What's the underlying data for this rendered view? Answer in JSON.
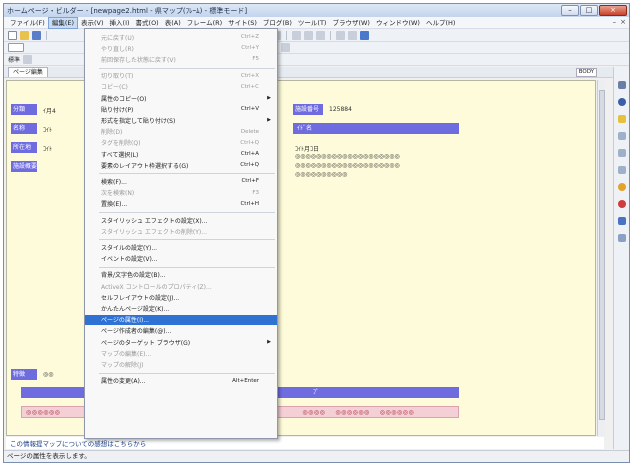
{
  "window": {
    "title": "ホームページ・ビルダー - [newpage2.html - 県マップ(ﾌﾚｰﾑ) - 標準モード]",
    "controls": [
      "–",
      "□",
      "×"
    ]
  },
  "menubar": [
    "ファイル(F)",
    "編集(E)",
    "表示(V)",
    "挿入(I)",
    "書式(O)",
    "表(A)",
    "フレーム(R)",
    "サイト(S)",
    "ブログ(B)",
    "ツール(T)",
    "ブラウザ(W)",
    "ウィンドウ(W)",
    "ヘルプ(H)"
  ],
  "menubar_active": "編集(E)",
  "mdi_controls": [
    "–",
    "×"
  ],
  "toolbar3": {
    "label": "標準"
  },
  "tabbar": {
    "tab": "ページ編集",
    "tags": [
      "BODY"
    ]
  },
  "editor": {
    "rows": [
      {
        "label": "分類",
        "text": "ｲ月4"
      },
      {
        "label": "名称",
        "text": "ｺｲﾄ"
      },
      {
        "label": "所在地",
        "text": "ｺｲﾄ"
      },
      {
        "label": "施設概要",
        "text": ""
      }
    ],
    "right_label": "施設番号",
    "right_value": "125884",
    "right_band_text": "ｲﾄﾞ名",
    "right_line": "ｺｲﾄ月ｺ日",
    "circle_rows": [
      "◎◎◎◎◎◎◎◎◎◎◎◎◎◎◎◎◎◎◎◎",
      "◎◎◎◎◎◎◎◎◎◎◎◎◎◎◎◎◎◎◎◎",
      "◎◎◎◎◎◎◎◎◎◎"
    ],
    "bottom_label": "特徴",
    "bottom_text": "◎◎",
    "band2_text": "ﾌﾟ",
    "pink_cells": [
      "◎◎◎◎◎◎",
      "◎◎◎◎",
      "◎◎◎◎◎◎",
      "◎◎◎◎◎◎"
    ]
  },
  "infobar": "この情報提マップについての感想はこちらから",
  "statusbar": "ページの属性を表示します。",
  "edit_menu": [
    {
      "label": "元に戻す(U)",
      "shortcut": "Ctrl+Z",
      "disabled": true
    },
    {
      "label": "やり直し(R)",
      "shortcut": "Ctrl+Y",
      "disabled": true
    },
    {
      "label": "前回保存した状態に戻す(V)",
      "shortcut": "F5",
      "disabled": true
    },
    {
      "sep": true
    },
    {
      "label": "切り取り(T)",
      "shortcut": "Ctrl+X",
      "disabled": true
    },
    {
      "label": "コピー(C)",
      "shortcut": "Ctrl+C",
      "disabled": true
    },
    {
      "label": "属性のコピー(O)",
      "arrow": true
    },
    {
      "label": "貼り付け(P)",
      "shortcut": "Ctrl+V"
    },
    {
      "label": "形式を指定して貼り付け(S)",
      "arrow": true
    },
    {
      "label": "削除(D)",
      "shortcut": "Delete",
      "disabled": true
    },
    {
      "label": "タグを削除(Q)",
      "shortcut": "Ctrl+Q",
      "disabled": true
    },
    {
      "label": "すべて選択(L)",
      "shortcut": "Ctrl+A"
    },
    {
      "label": "要素のレイアウト枠選択する(G)",
      "shortcut": "Ctrl+Q"
    },
    {
      "sep": true
    },
    {
      "label": "検索(F)...",
      "shortcut": "Ctrl+F"
    },
    {
      "label": "次を検索(N)",
      "shortcut": "F3",
      "disabled": true
    },
    {
      "label": "置換(E)...",
      "shortcut": "Ctrl+H"
    },
    {
      "sep": true
    },
    {
      "label": "スタイリッシュ エフェクトの設定(X)..."
    },
    {
      "label": "スタイリッシュ エフェクトの削除(Y)...",
      "disabled": true
    },
    {
      "sep": true
    },
    {
      "label": "スタイルの設定(Y)..."
    },
    {
      "label": "イベントの設定(V)..."
    },
    {
      "sep": true
    },
    {
      "label": "背景/文字色の設定(B)..."
    },
    {
      "label": "ActiveX コントロールのプロパティ(Z)...",
      "disabled": true
    },
    {
      "label": "セルフレイアウトの設定(J)..."
    },
    {
      "label": "かんたんページ設定(K)..."
    },
    {
      "label": "ページの属性(I)...",
      "highlight": true
    },
    {
      "label": "ページ作成者の編集(@)..."
    },
    {
      "label": "ページのターゲット ブラウザ(G)",
      "arrow": true
    },
    {
      "label": "マップの編集(E)...",
      "disabled": true
    },
    {
      "label": "マップの解除(J)",
      "disabled": true
    },
    {
      "sep": true
    },
    {
      "label": "属性の変更(A)...",
      "shortcut": "Alt+Enter"
    }
  ],
  "colors": {
    "label_bg": "#6f6ce0",
    "editor_bg": "#fdfbd9",
    "highlight": "#2f72d4",
    "pink": "#f4cfd6"
  }
}
